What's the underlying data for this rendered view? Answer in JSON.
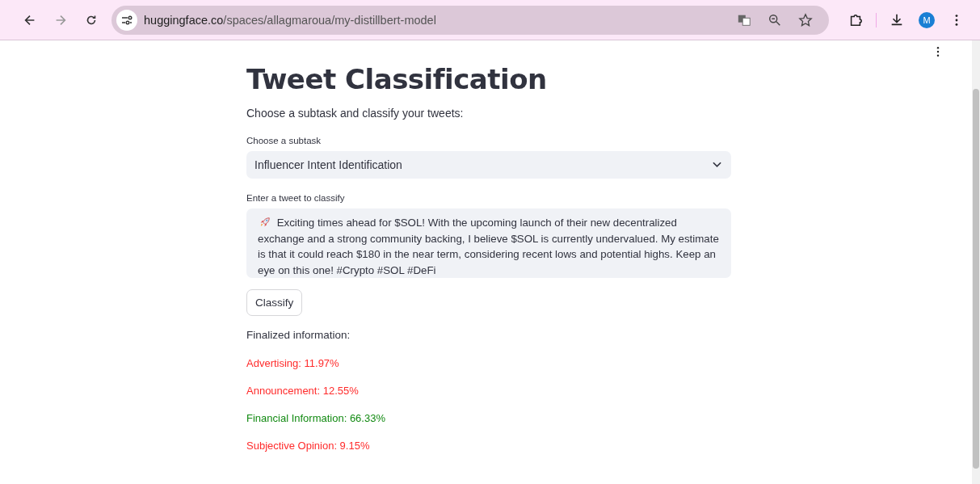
{
  "browser": {
    "url_host": "huggingface.co",
    "url_path": "/spaces/allagmaroua/my-distillbert-model",
    "profile_initial": "M"
  },
  "title": "Tweet Classification",
  "intro": "Choose a subtask and classify your tweets:",
  "subtask": {
    "label": "Choose a subtask",
    "value": "Influencer Intent Identification"
  },
  "tweet": {
    "label": "Enter a tweet to classify",
    "value": "Exciting times ahead for $SOL! With the upcoming launch of their new decentralized exchange and a strong community backing, I believe $SOL is currently undervalued. My estimate is that it could reach $180 in the near term, considering recent lows and potential highs. Keep an eye on this one! #Crypto #SOL #DeFi"
  },
  "button": "Classify",
  "results_heading": "Finalized information:",
  "results": [
    {
      "text": "Advertising: 11.97%",
      "color": "#ff2b2b"
    },
    {
      "text": "Announcement: 12.55%",
      "color": "#ff2b2b"
    },
    {
      "text": "Financial Information: 66.33%",
      "color": "#128a12"
    },
    {
      "text": "Subjective Opinion: 9.15%",
      "color": "#ff2b2b"
    }
  ]
}
